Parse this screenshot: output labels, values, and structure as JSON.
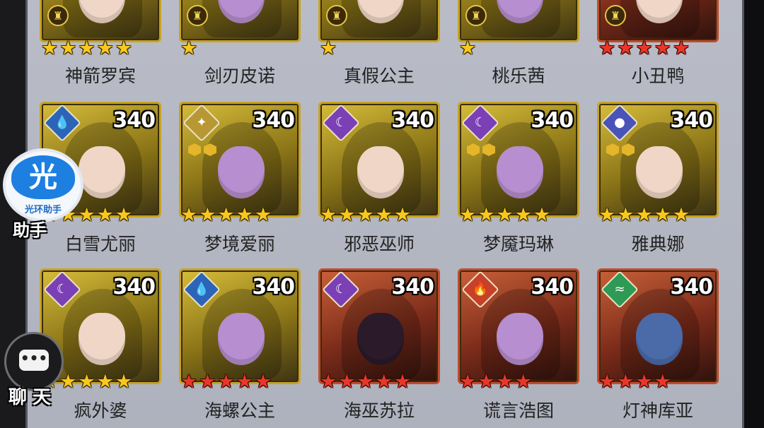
{
  "colors": {
    "gold_frame": "#c7a223",
    "red_frame": "#c14a2c",
    "star_gold": "#f7c81e",
    "star_red": "#e8372a",
    "panel": "#b9bcc7"
  },
  "roster": {
    "row1": [
      {
        "name": "神箭罗宾",
        "level": "",
        "stars": 5,
        "star_color": "gold",
        "frame": "gold",
        "badge": "chess-rook-icon"
      },
      {
        "name": "剑刃皮诺",
        "level": "",
        "stars": 1,
        "star_color": "gold",
        "frame": "gold",
        "badge": "chess-rook-icon"
      },
      {
        "name": "真假公主",
        "level": "",
        "stars": 1,
        "star_color": "gold",
        "frame": "gold",
        "badge": "chess-rook-icon"
      },
      {
        "name": "桃乐茜",
        "level": "",
        "stars": 1,
        "star_color": "gold",
        "frame": "gold",
        "badge": "chess-rook-icon"
      },
      {
        "name": "小丑鸭",
        "level": "",
        "stars": 5,
        "star_color": "red",
        "frame": "red",
        "badge": "chess-rook-icon"
      }
    ],
    "row2": [
      {
        "name": "白雪尤丽",
        "level": "340",
        "stars": 5,
        "star_color": "gold",
        "frame": "gold",
        "element": "water-drop-icon",
        "pips": 0
      },
      {
        "name": "梦境爱丽",
        "level": "340",
        "stars": 5,
        "star_color": "gold",
        "frame": "gold",
        "element": "light-star-icon",
        "pips": 2
      },
      {
        "name": "邪恶巫师",
        "level": "340",
        "stars": 5,
        "star_color": "gold",
        "frame": "gold",
        "element": "dark-moon-icon",
        "pips": 0
      },
      {
        "name": "梦魇玛琳",
        "level": "340",
        "stars": 5,
        "star_color": "gold",
        "frame": "gold",
        "element": "dark-moon-icon",
        "pips": 2
      },
      {
        "name": "雅典娜",
        "level": "340",
        "stars": 5,
        "star_color": "gold",
        "frame": "gold",
        "element": "cosmic-planet-icon",
        "pips": 2
      }
    ],
    "row3": [
      {
        "name": "疯外婆",
        "level": "340",
        "stars": 5,
        "star_color": "gold",
        "frame": "gold",
        "element": "dark-moon-icon",
        "pips": 0
      },
      {
        "name": "海螺公主",
        "level": "340",
        "stars": 5,
        "star_color": "red",
        "frame": "gold",
        "element": "water-drop-icon",
        "pips": 0
      },
      {
        "name": "海巫苏拉",
        "level": "340",
        "stars": 5,
        "star_color": "red",
        "frame": "red",
        "element": "dark-moon-icon",
        "pips": 0
      },
      {
        "name": "谎言浩图",
        "level": "340",
        "stars": 4,
        "star_color": "red",
        "frame": "red",
        "element": "fire-icon",
        "pips": 0
      },
      {
        "name": "灯神库亚",
        "level": "340",
        "stars": 4,
        "star_color": "red",
        "frame": "red",
        "element": "wind-icon",
        "pips": 0
      }
    ]
  },
  "halo_assistant": {
    "glyph": "光",
    "sublabel": "光环助手",
    "caption": "助手"
  },
  "chat": {
    "glyph": "•••",
    "caption": "聊天"
  }
}
